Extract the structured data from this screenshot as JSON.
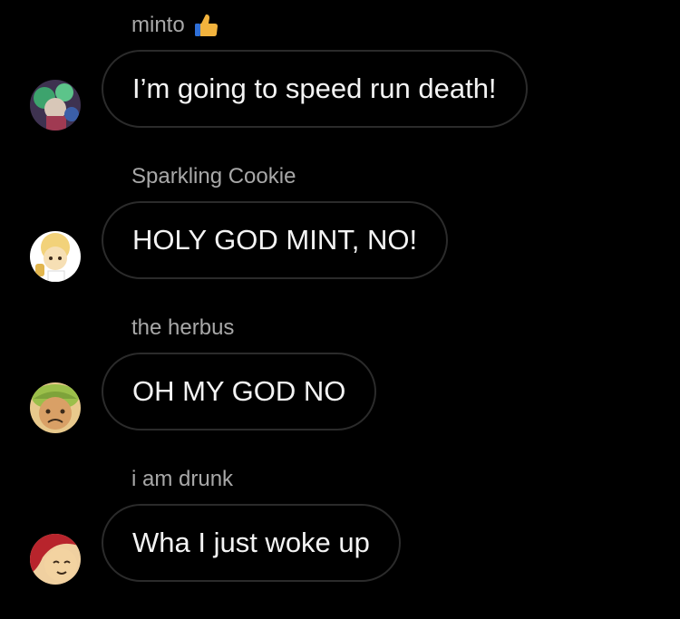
{
  "messages": [
    {
      "sender": "minto",
      "sender_icon": "thumbs-up-icon",
      "text": "I’m going to speed run death!",
      "avatar": "green-haired-cookie-avatar"
    },
    {
      "sender": "Sparkling Cookie",
      "text": "HOLY GOD MINT, NO!",
      "avatar": "blonde-cookie-avatar"
    },
    {
      "sender": "the herbus",
      "text": "OH MY GOD NO",
      "avatar": "herb-cookie-avatar"
    },
    {
      "sender": "i am drunk",
      "text": "Wha I just woke up",
      "avatar": "red-haired-cookie-avatar"
    }
  ],
  "colors": {
    "background": "#000000",
    "sender_text": "#a8a8a8",
    "bubble_border": "#2b2b2b",
    "message_text": "#f4f4f4"
  }
}
